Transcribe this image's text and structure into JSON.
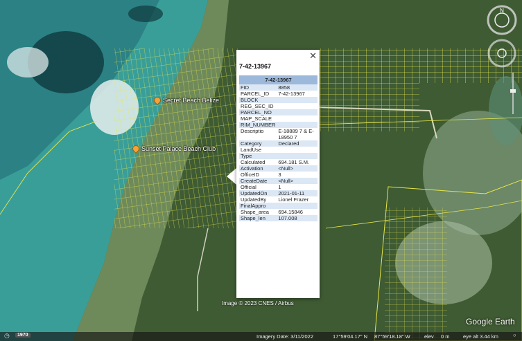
{
  "placemarks": [
    {
      "label": "Secret Beach Belize"
    },
    {
      "label": "Sunset Palace Beach Club"
    }
  ],
  "balloon": {
    "title": "7-42-13967",
    "table_header": "7-42-13967",
    "rows": [
      {
        "key": "FID",
        "value": "8858"
      },
      {
        "key": "PARCEL_ID",
        "value": "7-42-13967"
      },
      {
        "key": "BLOCK",
        "value": ""
      },
      {
        "key": "REG_SEC_ID",
        "value": ""
      },
      {
        "key": "PARCEL_NO",
        "value": ""
      },
      {
        "key": "MAP_SCALE",
        "value": ""
      },
      {
        "key": "RIM_NUMBER",
        "value": ""
      },
      {
        "key": "Descriptio",
        "value": "E-18889 7 & E-18950 7"
      },
      {
        "key": "Category",
        "value": "Declared"
      },
      {
        "key": "LandUse",
        "value": ""
      },
      {
        "key": "Type",
        "value": ""
      },
      {
        "key": "Calculated",
        "value": "694.181 S.M."
      },
      {
        "key": "Activation",
        "value": "<Null>"
      },
      {
        "key": "OfficeID",
        "value": "3"
      },
      {
        "key": "CreateDate",
        "value": "<Null>"
      },
      {
        "key": "Official",
        "value": "1"
      },
      {
        "key": "UpdatedOn",
        "value": "2021-01-11"
      },
      {
        "key": "UpdatedBy",
        "value": "Lionel Frazer"
      },
      {
        "key": "FinalAppro",
        "value": ""
      },
      {
        "key": "Shape_area",
        "value": "694.15846"
      },
      {
        "key": "Shape_len",
        "value": "107.008"
      }
    ]
  },
  "attribution": "Image © 2023 CNES / Airbus",
  "logo": "Google Earth",
  "status": {
    "year": "1970",
    "imagery_date": "Imagery Date: 3/11/2022",
    "lat": "17°59'04.17\" N",
    "lon": "87°59'18.18\" W",
    "elev_label": "elev",
    "elev_value": "0 m",
    "eye_alt": "eye alt  3.44 km"
  },
  "colors": {
    "parcel_lines": "#e8e84a",
    "sea": "#4fb3a6",
    "land": "#4a6a3a",
    "header": "#9cb8da",
    "alt_row": "#dbe7f5"
  }
}
